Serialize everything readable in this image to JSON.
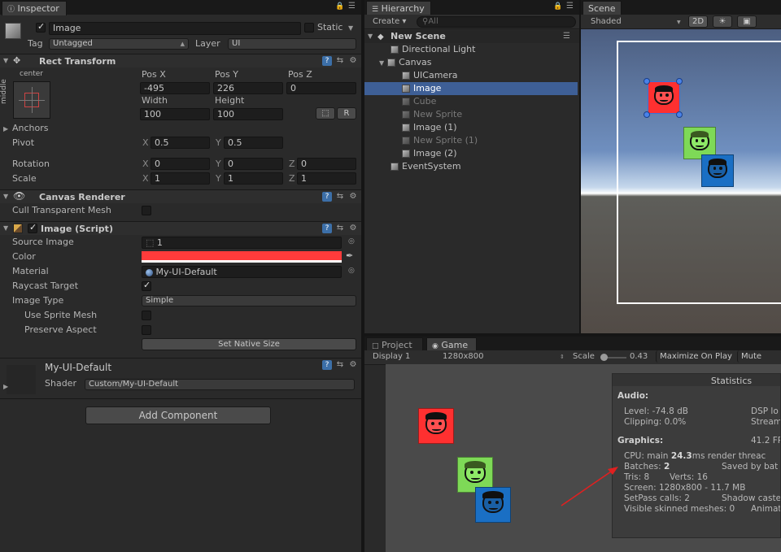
{
  "inspector": {
    "tab": "Inspector",
    "object": {
      "name": "Image",
      "static_label": "Static",
      "tag_label": "Tag",
      "tag_value": "Untagged",
      "layer_label": "Layer",
      "layer_value": "UI"
    },
    "rect_transform": {
      "title": "Rect Transform",
      "anchor_h": "center",
      "anchor_v": "middle",
      "col_labels": [
        "Pos X",
        "Pos Y",
        "Pos Z"
      ],
      "pos": [
        "-495",
        "226",
        "0"
      ],
      "size_labels": [
        "Width",
        "Height"
      ],
      "size": [
        "100",
        "100"
      ],
      "r_button": "R",
      "anchors_label": "Anchors",
      "pivot_label": "Pivot",
      "pivot": [
        "0.5",
        "0.5"
      ],
      "rotation_label": "Rotation",
      "rotation": [
        "0",
        "0",
        "0"
      ],
      "scale_label": "Scale",
      "scale": [
        "1",
        "1",
        "1"
      ],
      "axis": [
        "X",
        "Y",
        "Z"
      ]
    },
    "canvas_renderer": {
      "title": "Canvas Renderer",
      "cull_label": "Cull Transparent Mesh"
    },
    "image_script": {
      "title": "Image (Script)",
      "source_label": "Source Image",
      "source_value": "1",
      "color_label": "Color",
      "color_value": "#ff3b3b",
      "material_label": "Material",
      "material_value": "My-UI-Default",
      "raycast_label": "Raycast Target",
      "image_type_label": "Image Type",
      "image_type_value": "Simple",
      "use_sprite_mesh_label": "Use Sprite Mesh",
      "preserve_label": "Preserve Aspect",
      "native_size_button": "Set Native Size"
    },
    "material": {
      "name": "My-UI-Default",
      "shader_label": "Shader",
      "shader_value": "Custom/My-UI-Default"
    },
    "add_component": "Add Component"
  },
  "hierarchy": {
    "tab": "Hierarchy",
    "create": "Create",
    "search_placeholder": "All",
    "scene": "New Scene",
    "items": [
      {
        "label": "Directional Light"
      },
      {
        "label": "Canvas"
      },
      {
        "label": "UICamera"
      },
      {
        "label": "Image"
      },
      {
        "label": "Cube"
      },
      {
        "label": "New Sprite"
      },
      {
        "label": "Image (1)"
      },
      {
        "label": "New Sprite (1)"
      },
      {
        "label": "Image (2)"
      },
      {
        "label": "EventSystem"
      }
    ]
  },
  "scene": {
    "tab": "Scene",
    "shading": "Shaded",
    "mode_2d": "2D"
  },
  "game": {
    "tab_project": "Project",
    "tab_game": "Game",
    "display": "Display 1",
    "resolution": "1280x800",
    "scale_label": "Scale",
    "scale_value": "0.43",
    "maximize": "Maximize On Play",
    "mute": "Mute Audi"
  },
  "statistics": {
    "title": "Statistics",
    "audio_hd": "Audio:",
    "level": "Level: -74.8 dB",
    "dsp": "DSP lo",
    "clipping": "Clipping: 0.0%",
    "stream": "Stream",
    "graphics_hd": "Graphics:",
    "fps": "41.2 FP",
    "cpu_prefix": "CPU: main",
    "cpu_value": "24.3",
    "cpu_suffix": "ms  render threac",
    "batches_prefix": "Batches:",
    "batches_value": "2",
    "saved": "Saved by bat",
    "tris": "Tris: 8",
    "verts": "Verts: 16",
    "screen": "Screen: 1280x800 - 11.7 MB",
    "setpass": "SetPass calls: 2",
    "shadow": "Shadow caste",
    "skinned": "Visible skinned meshes: 0",
    "anim": "Animat"
  },
  "colors": {
    "red": "#ff3030",
    "green": "#7ed957",
    "blue": "#1a6fc4",
    "selection": "#3e5f96"
  }
}
